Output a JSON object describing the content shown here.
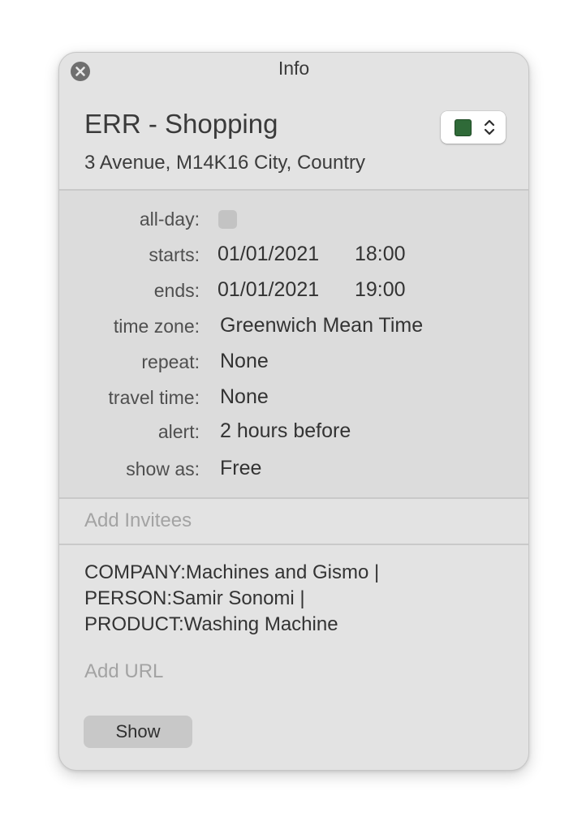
{
  "window": {
    "title": "Info"
  },
  "event": {
    "title": "ERR - Shopping",
    "location": "3 Avenue, M14K16 City, Country",
    "calendar_color": "#2f6a38"
  },
  "details": {
    "all_day": {
      "label": "all-day:",
      "checked": false
    },
    "starts": {
      "label": "starts:",
      "date": "01/01/2021",
      "time": "18:00"
    },
    "ends": {
      "label": "ends:",
      "date": "01/01/2021",
      "time": "19:00"
    },
    "time_zone": {
      "label": "time zone:",
      "value": "Greenwich Mean Time"
    },
    "repeat": {
      "label": "repeat:",
      "value": "None"
    },
    "travel_time": {
      "label": "travel time:",
      "value": "None"
    },
    "alert": {
      "label": "alert:",
      "value": "2 hours before"
    },
    "show_as": {
      "label": "show as:",
      "value": "Free"
    }
  },
  "invitees": {
    "placeholder": "Add Invitees"
  },
  "notes": {
    "lines": [
      "COMPANY:Machines and Gismo |",
      "PERSON:Samir Sonomi |",
      "PRODUCT:Washing Machine"
    ]
  },
  "url": {
    "placeholder": "Add URL"
  },
  "actions": {
    "show_label": "Show"
  },
  "icons": {
    "close": "close-icon",
    "chevron": "chevron-updown-icon"
  }
}
